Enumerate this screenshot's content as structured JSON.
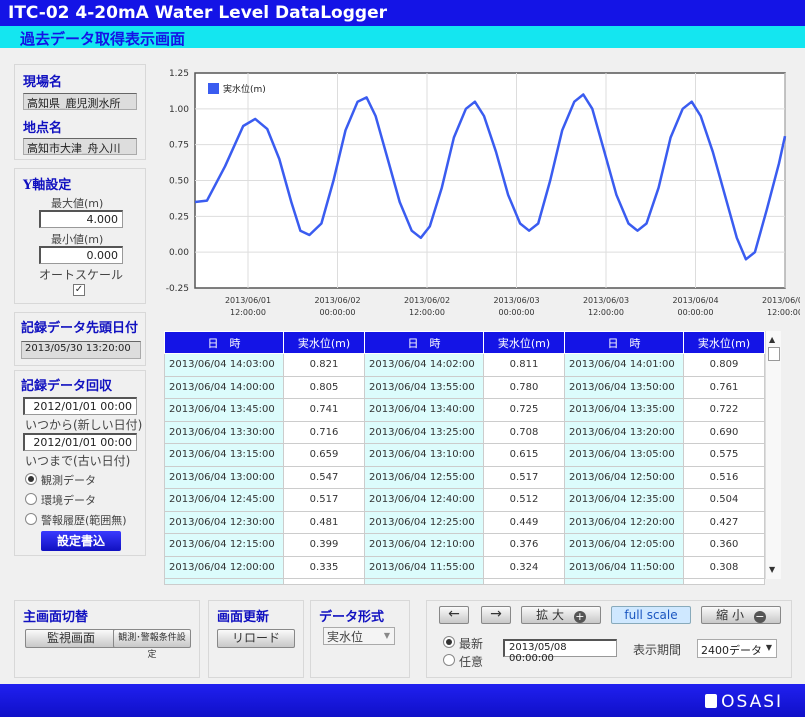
{
  "header": {
    "title": "ITC-02 4-20mA Water Level DataLogger",
    "subtitle": "過去データ取得表示画面"
  },
  "site": {
    "site_label": "現場名",
    "site_value": "高知県_鹿児測水所",
    "point_label": "地点名",
    "point_value": "高知市大津_舟入川"
  },
  "yaxis": {
    "title": "Y軸設定",
    "max_label": "最大値(m)",
    "max_value": "4.000",
    "min_label": "最小値(m)",
    "min_value": "0.000",
    "autoscale_label": "オートスケール",
    "autoscale_checked": true
  },
  "head_date": {
    "title": "記録データ先頭日付",
    "value": "2013/05/30 13:20:00"
  },
  "recover": {
    "title": "記録データ回収",
    "from_value": "2012/01/01 00:00",
    "from_label": "いつから(新しい日付)",
    "to_value": "2012/01/01 00:00",
    "to_label": "いつまで(古い日付)",
    "options": [
      "観測データ",
      "環境データ",
      "警報履歴(範囲無)"
    ],
    "selected": 0,
    "write_button": "設定書込"
  },
  "chart_data": {
    "type": "line",
    "title": "",
    "xlabel": "",
    "ylabel": "",
    "ylim": [
      -0.25,
      1.25
    ],
    "yticks": [
      "1.25",
      "1.00",
      "0.75",
      "0.50",
      "0.25",
      "0.00",
      "-0.25"
    ],
    "xticks": [
      [
        "2013/06/01",
        "12:00:00"
      ],
      [
        "2013/06/02",
        "00:00:00"
      ],
      [
        "2013/06/02",
        "12:00:00"
      ],
      [
        "2013/06/03",
        "00:00:00"
      ],
      [
        "2013/06/03",
        "12:00:00"
      ],
      [
        "2013/06/04",
        "00:00:00"
      ],
      [
        "2013/06/04",
        "12:00:00"
      ]
    ],
    "series": [
      {
        "name": "実水位(m)",
        "color": "#3a5cf0",
        "points": [
          [
            0,
            0.35
          ],
          [
            2,
            0.36
          ],
          [
            5,
            0.6
          ],
          [
            8,
            0.88
          ],
          [
            10,
            0.93
          ],
          [
            12,
            0.86
          ],
          [
            14,
            0.65
          ],
          [
            16,
            0.35
          ],
          [
            17.5,
            0.15
          ],
          [
            19,
            0.12
          ],
          [
            21,
            0.2
          ],
          [
            23,
            0.5
          ],
          [
            25,
            0.85
          ],
          [
            27,
            1.05
          ],
          [
            28.5,
            1.08
          ],
          [
            30,
            0.95
          ],
          [
            32,
            0.65
          ],
          [
            34,
            0.35
          ],
          [
            36,
            0.15
          ],
          [
            37.5,
            0.1
          ],
          [
            39,
            0.18
          ],
          [
            41,
            0.45
          ],
          [
            43,
            0.8
          ],
          [
            45,
            1.0
          ],
          [
            46.5,
            1.05
          ],
          [
            48,
            0.95
          ],
          [
            50,
            0.7
          ],
          [
            52,
            0.4
          ],
          [
            54,
            0.2
          ],
          [
            55.5,
            0.15
          ],
          [
            57,
            0.2
          ],
          [
            59,
            0.5
          ],
          [
            61,
            0.85
          ],
          [
            63,
            1.05
          ],
          [
            64.5,
            1.1
          ],
          [
            66,
            1.0
          ],
          [
            68,
            0.7
          ],
          [
            70,
            0.4
          ],
          [
            72,
            0.2
          ],
          [
            73.5,
            0.15
          ],
          [
            75,
            0.2
          ],
          [
            77,
            0.45
          ],
          [
            79,
            0.8
          ],
          [
            81,
            1.0
          ],
          [
            82.5,
            1.05
          ],
          [
            84,
            0.95
          ],
          [
            86,
            0.7
          ],
          [
            88,
            0.4
          ],
          [
            90,
            0.1
          ],
          [
            91.5,
            -0.05
          ],
          [
            93,
            0.0
          ],
          [
            95,
            0.3
          ],
          [
            97,
            0.62
          ],
          [
            98,
            0.81
          ]
        ]
      }
    ],
    "x_domain": [
      0,
      98
    ]
  },
  "table": {
    "headers": [
      "日　時",
      "実水位(m)",
      "日　時",
      "実水位(m)",
      "日　時",
      "実水位(m)"
    ],
    "rows": [
      [
        "2013/06/04 14:03:00",
        "0.821",
        "2013/06/04 14:02:00",
        "0.811",
        "2013/06/04 14:01:00",
        "0.809"
      ],
      [
        "2013/06/04 14:00:00",
        "0.805",
        "2013/06/04 13:55:00",
        "0.780",
        "2013/06/04 13:50:00",
        "0.761"
      ],
      [
        "2013/06/04 13:45:00",
        "0.741",
        "2013/06/04 13:40:00",
        "0.725",
        "2013/06/04 13:35:00",
        "0.722"
      ],
      [
        "2013/06/04 13:30:00",
        "0.716",
        "2013/06/04 13:25:00",
        "0.708",
        "2013/06/04 13:20:00",
        "0.690"
      ],
      [
        "2013/06/04 13:15:00",
        "0.659",
        "2013/06/04 13:10:00",
        "0.615",
        "2013/06/04 13:05:00",
        "0.575"
      ],
      [
        "2013/06/04 13:00:00",
        "0.547",
        "2013/06/04 12:55:00",
        "0.517",
        "2013/06/04 12:50:00",
        "0.516"
      ],
      [
        "2013/06/04 12:45:00",
        "0.517",
        "2013/06/04 12:40:00",
        "0.512",
        "2013/06/04 12:35:00",
        "0.504"
      ],
      [
        "2013/06/04 12:30:00",
        "0.481",
        "2013/06/04 12:25:00",
        "0.449",
        "2013/06/04 12:20:00",
        "0.427"
      ],
      [
        "2013/06/04 12:15:00",
        "0.399",
        "2013/06/04 12:10:00",
        "0.376",
        "2013/06/04 12:05:00",
        "0.360"
      ],
      [
        "2013/06/04 12:00:00",
        "0.335",
        "2013/06/04 11:55:00",
        "0.324",
        "2013/06/04 11:50:00",
        "0.308"
      ]
    ]
  },
  "switch": {
    "title": "主画面切替",
    "monitor_button": "監視画面",
    "alarm_button": "観測･警報条件設定"
  },
  "refresh": {
    "title": "画面更新",
    "reload_button": "リロード"
  },
  "format": {
    "title": "データ形式",
    "selected": "実水位"
  },
  "nav": {
    "zoom_in": "拡 大",
    "full_scale": "full scale",
    "zoom_out": "縮 小",
    "latest": "最新",
    "arbitrary": "任意",
    "date_value": "2013/05/08 00:00:00",
    "period_label": "表示期間",
    "period_value": "2400データ"
  },
  "footer": {
    "brand": "OSASI"
  }
}
